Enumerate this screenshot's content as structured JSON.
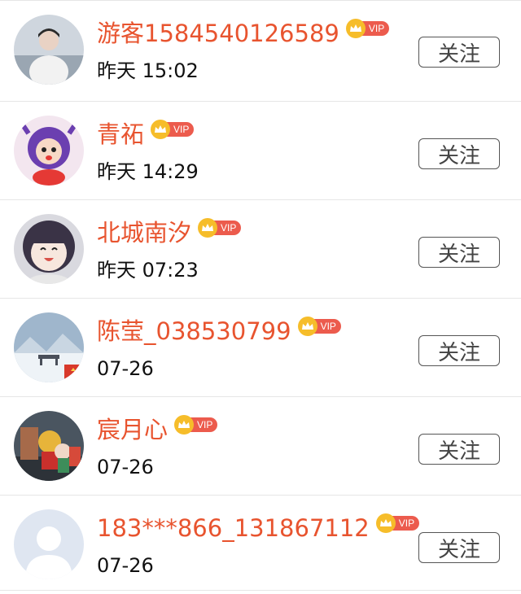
{
  "users": [
    {
      "name": "游客1584540126589",
      "vip": "VIP",
      "time": "昨天 15:02",
      "follow": "关注",
      "avatar": "avatar-person-white-icon"
    },
    {
      "name": "青祏",
      "vip": "VIP",
      "time": "昨天 14:29",
      "follow": "关注",
      "avatar": "avatar-cartoon-girl-icon"
    },
    {
      "name": "北城南汐",
      "vip": "VIP",
      "time": "昨天 07:23",
      "follow": "关注",
      "avatar": "avatar-anime-girl-icon"
    },
    {
      "name": "陈莹_038530799",
      "vip": "VIP",
      "time": "07-26",
      "follow": "关注",
      "avatar": "avatar-snow-scene-icon"
    },
    {
      "name": "宸月心",
      "vip": "VIP",
      "time": "07-26",
      "follow": "关注",
      "avatar": "avatar-photo-toy-icon"
    },
    {
      "name": "183***866_131867112",
      "vip": "VIP",
      "time": "07-26",
      "follow": "关注",
      "avatar": "avatar-default-icon"
    }
  ],
  "colors": {
    "name": "#e8542f",
    "vip_tag": "#ec5b4d",
    "crown": "#f6bd2a",
    "divider": "#e6e6e6"
  }
}
